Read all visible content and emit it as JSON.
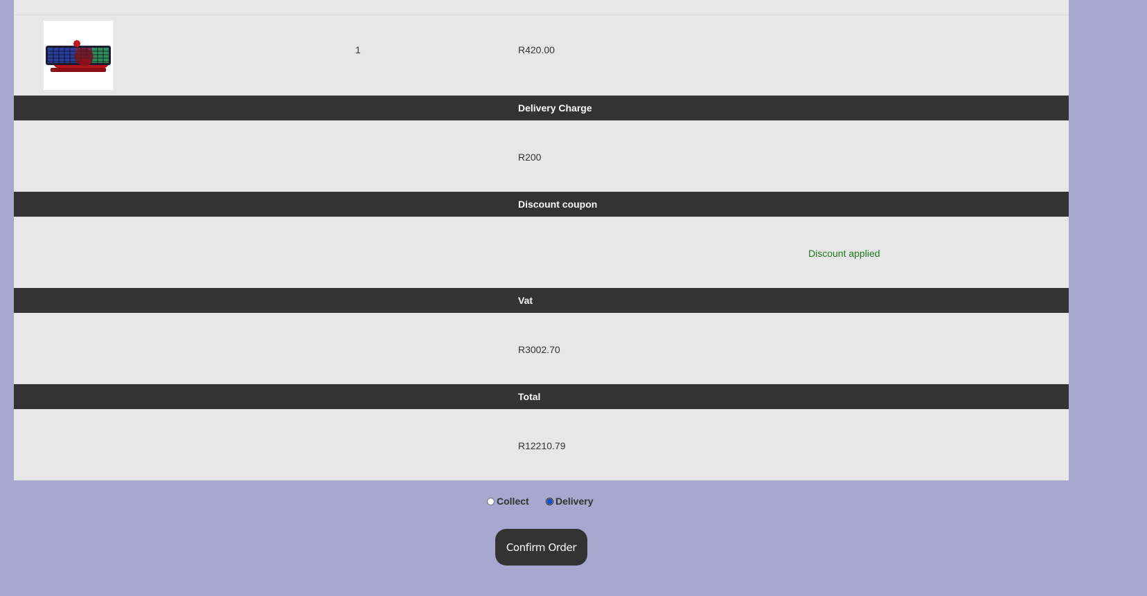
{
  "order_item": {
    "image_icon": "keyboard-product-image",
    "quantity": "1",
    "price": "R420.00"
  },
  "sections": {
    "delivery": {
      "heading": "Delivery Charge",
      "value": "R200"
    },
    "discount": {
      "heading": "Discount coupon",
      "status": "Discount applied"
    },
    "vat": {
      "heading": "Vat",
      "value": "R3002.70"
    },
    "total": {
      "heading": "Total",
      "value": "R12210.79"
    }
  },
  "fulfillment": {
    "options": [
      {
        "label": "Collect",
        "checked": false
      },
      {
        "label": "Delivery",
        "checked": true
      }
    ]
  },
  "actions": {
    "confirm_label": "Confirm Order"
  },
  "colors": {
    "page_background": "#a7a7cf",
    "panel_background": "#e7e7e7",
    "header_background": "#333333",
    "success_text": "#1e7a1e",
    "button_background": "#333333"
  }
}
